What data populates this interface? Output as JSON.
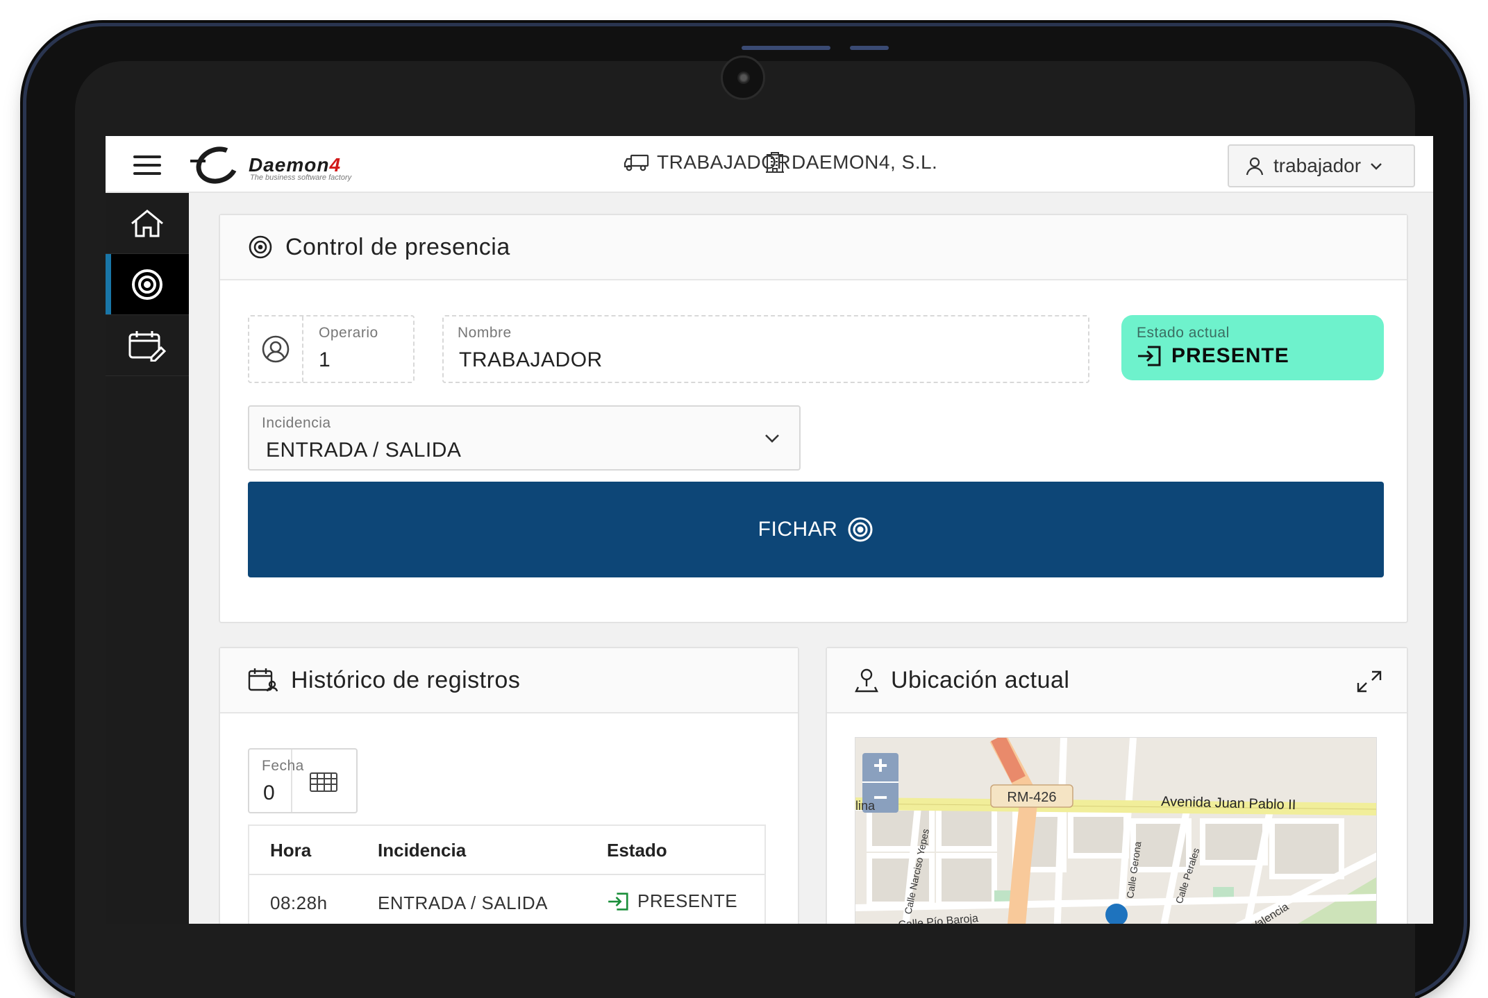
{
  "brand": {
    "name": "Daemon",
    "name_suffix": "4",
    "tagline": "The business software factory"
  },
  "topbar": {
    "role_label": "TRABAJADOR",
    "company_label": "DAEMON4, S.L.",
    "user_label": "trabajador"
  },
  "sidebar": {
    "items": [
      {
        "icon": "home-icon",
        "active": false
      },
      {
        "icon": "target-icon",
        "active": true
      },
      {
        "icon": "calendar-edit-icon",
        "active": false
      }
    ]
  },
  "presence": {
    "title": "Control de presencia",
    "operario_label": "Operario",
    "operario_value": "1",
    "nombre_label": "Nombre",
    "nombre_value": "TRABAJADOR",
    "estado_label": "Estado actual",
    "estado_value": "PRESENTE",
    "incidencia_label": "Incidencia",
    "incidencia_value": "ENTRADA / SALIDA",
    "fichar_label": "FICHAR"
  },
  "history": {
    "title": "Histórico de registros",
    "fecha_label": "Fecha",
    "fecha_value": "0",
    "columns": [
      "Hora",
      "Incidencia",
      "Estado"
    ],
    "rows": [
      {
        "hora": "08:28h",
        "incidencia": "ENTRADA / SALIDA",
        "estado": "PRESENTE"
      }
    ]
  },
  "location": {
    "title": "Ubicación actual",
    "zoom_in": "+",
    "zoom_out": "−",
    "map_labels": {
      "road_code": "RM-426",
      "avenue": "Avenida Juan Pablo II",
      "street_1": "Calle Narciso Yepes",
      "street_2": "Calle Pío Baroja",
      "street_3": "Calle Gerona",
      "street_4": "Calle Perales",
      "street_5": "de Valencia",
      "fragment": "lina"
    }
  },
  "colors": {
    "primary": "#0d4677",
    "status_present": "#6ef2cc",
    "sidebar_bg": "#1c1c1c",
    "sidebar_active_accent": "#1976a8",
    "present_icon": "#1a8f3a"
  }
}
